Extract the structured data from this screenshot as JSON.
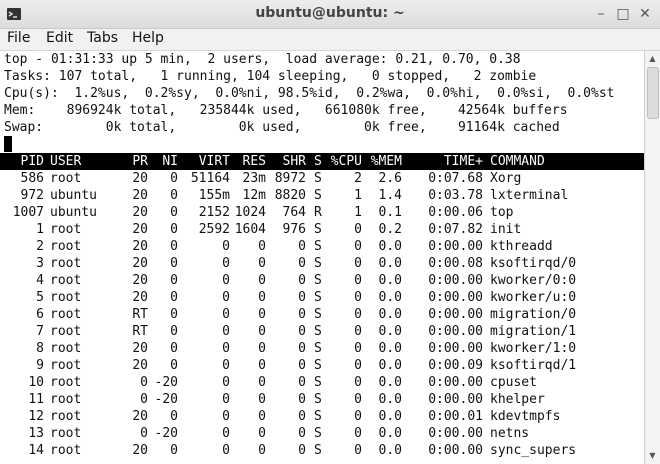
{
  "window": {
    "title": "ubuntu@ubuntu: ~",
    "minimize": "–",
    "maximize": "□",
    "close": "✕",
    "menu": [
      "File",
      "Edit",
      "Tabs",
      "Help"
    ]
  },
  "top": {
    "summary": [
      "top - 01:31:33 up 5 min,  2 users,  load average: 0.21, 0.70, 0.38",
      "Tasks: 107 total,   1 running, 104 sleeping,   0 stopped,   2 zombie",
      "Cpu(s):  1.2%us,  0.2%sy,  0.0%ni, 98.5%id,  0.2%wa,  0.0%hi,  0.0%si,  0.0%st",
      "Mem:    896924k total,   235844k used,   661080k free,    42564k buffers",
      "Swap:        0k total,        0k used,        0k free,    91164k cached"
    ],
    "columns": [
      "PID",
      "USER",
      "PR",
      "NI",
      "VIRT",
      "RES",
      "SHR",
      "S",
      "%CPU",
      "%MEM",
      "TIME+",
      "COMMAND"
    ],
    "rows": [
      [
        "586",
        "root",
        "20",
        "0",
        "51164",
        "23m",
        "8972",
        "S",
        "2",
        "2.6",
        "0:07.68",
        "Xorg"
      ],
      [
        "972",
        "ubuntu",
        "20",
        "0",
        "155m",
        "12m",
        "8820",
        "S",
        "1",
        "1.4",
        "0:03.78",
        "lxterminal"
      ],
      [
        "1007",
        "ubuntu",
        "20",
        "0",
        "2152",
        "1024",
        "764",
        "R",
        "1",
        "0.1",
        "0:00.06",
        "top"
      ],
      [
        "1",
        "root",
        "20",
        "0",
        "2592",
        "1604",
        "976",
        "S",
        "0",
        "0.2",
        "0:07.82",
        "init"
      ],
      [
        "2",
        "root",
        "20",
        "0",
        "0",
        "0",
        "0",
        "S",
        "0",
        "0.0",
        "0:00.00",
        "kthreadd"
      ],
      [
        "3",
        "root",
        "20",
        "0",
        "0",
        "0",
        "0",
        "S",
        "0",
        "0.0",
        "0:00.08",
        "ksoftirqd/0"
      ],
      [
        "4",
        "root",
        "20",
        "0",
        "0",
        "0",
        "0",
        "S",
        "0",
        "0.0",
        "0:00.00",
        "kworker/0:0"
      ],
      [
        "5",
        "root",
        "20",
        "0",
        "0",
        "0",
        "0",
        "S",
        "0",
        "0.0",
        "0:00.00",
        "kworker/u:0"
      ],
      [
        "6",
        "root",
        "RT",
        "0",
        "0",
        "0",
        "0",
        "S",
        "0",
        "0.0",
        "0:00.00",
        "migration/0"
      ],
      [
        "7",
        "root",
        "RT",
        "0",
        "0",
        "0",
        "0",
        "S",
        "0",
        "0.0",
        "0:00.00",
        "migration/1"
      ],
      [
        "8",
        "root",
        "20",
        "0",
        "0",
        "0",
        "0",
        "S",
        "0",
        "0.0",
        "0:00.00",
        "kworker/1:0"
      ],
      [
        "9",
        "root",
        "20",
        "0",
        "0",
        "0",
        "0",
        "S",
        "0",
        "0.0",
        "0:00.09",
        "ksoftirqd/1"
      ],
      [
        "10",
        "root",
        "0",
        "-20",
        "0",
        "0",
        "0",
        "S",
        "0",
        "0.0",
        "0:00.00",
        "cpuset"
      ],
      [
        "11",
        "root",
        "0",
        "-20",
        "0",
        "0",
        "0",
        "S",
        "0",
        "0.0",
        "0:00.00",
        "khelper"
      ],
      [
        "12",
        "root",
        "20",
        "0",
        "0",
        "0",
        "0",
        "S",
        "0",
        "0.0",
        "0:00.01",
        "kdevtmpfs"
      ],
      [
        "13",
        "root",
        "0",
        "-20",
        "0",
        "0",
        "0",
        "S",
        "0",
        "0.0",
        "0:00.00",
        "netns"
      ],
      [
        "14",
        "root",
        "20",
        "0",
        "0",
        "0",
        "0",
        "S",
        "0",
        "0.0",
        "0:00.00",
        "sync_supers"
      ]
    ]
  }
}
